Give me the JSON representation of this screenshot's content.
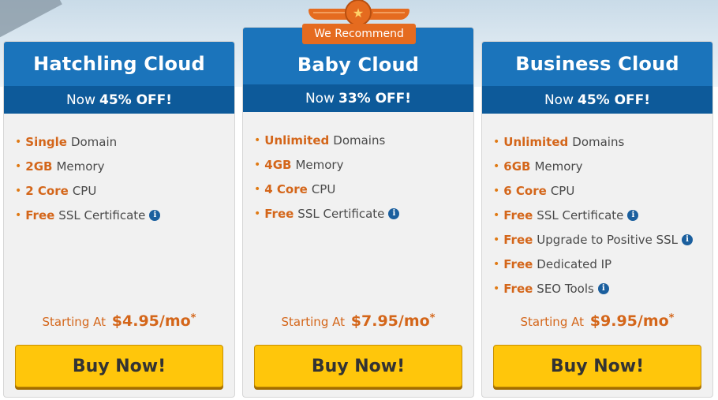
{
  "plans": [
    {
      "name": "Hatchling Cloud",
      "discount_prefix": "Now",
      "discount": "45% OFF!",
      "features": [
        {
          "highlight": "Single",
          "text": "Domain",
          "info": false
        },
        {
          "highlight": "2GB",
          "text": "Memory",
          "info": false
        },
        {
          "highlight": "2 Core",
          "text": "CPU",
          "info": false
        },
        {
          "highlight": "Free",
          "text": "SSL Certificate",
          "info": true
        }
      ],
      "price_prefix": "Starting At",
      "price": "$4.95/mo",
      "price_mark": "*",
      "button_label": "Buy Now!"
    },
    {
      "name": "Baby Cloud",
      "badge": "We Recommend",
      "discount_prefix": "Now",
      "discount": "33% OFF!",
      "features": [
        {
          "highlight": "Unlimited",
          "text": "Domains",
          "info": false
        },
        {
          "highlight": "4GB",
          "text": "Memory",
          "info": false
        },
        {
          "highlight": "4 Core",
          "text": "CPU",
          "info": false
        },
        {
          "highlight": "Free",
          "text": "SSL Certificate",
          "info": true
        }
      ],
      "price_prefix": "Starting At",
      "price": "$7.95/mo",
      "price_mark": "*",
      "button_label": "Buy Now!"
    },
    {
      "name": "Business Cloud",
      "discount_prefix": "Now",
      "discount": "45% OFF!",
      "features": [
        {
          "highlight": "Unlimited",
          "text": "Domains",
          "info": false
        },
        {
          "highlight": "6GB",
          "text": "Memory",
          "info": false
        },
        {
          "highlight": "6 Core",
          "text": "CPU",
          "info": false
        },
        {
          "highlight": "Free",
          "text": "SSL Certificate",
          "info": true
        },
        {
          "highlight": "Free",
          "text": "Upgrade to Positive SSL",
          "info": true
        },
        {
          "highlight": "Free",
          "text": "Dedicated IP",
          "info": false
        },
        {
          "highlight": "Free",
          "text": "SEO Tools",
          "info": true
        }
      ],
      "price_prefix": "Starting At",
      "price": "$9.95/mo",
      "price_mark": "*",
      "button_label": "Buy Now!"
    }
  ],
  "icons": {
    "bullet": "•",
    "info": "i",
    "star": "★"
  },
  "colors": {
    "header_blue": "#1b74bb",
    "discount_blue": "#0d5a9a",
    "accent_orange": "#d4661a",
    "button_yellow": "#ffc60b",
    "badge_orange": "#e56b1f"
  }
}
